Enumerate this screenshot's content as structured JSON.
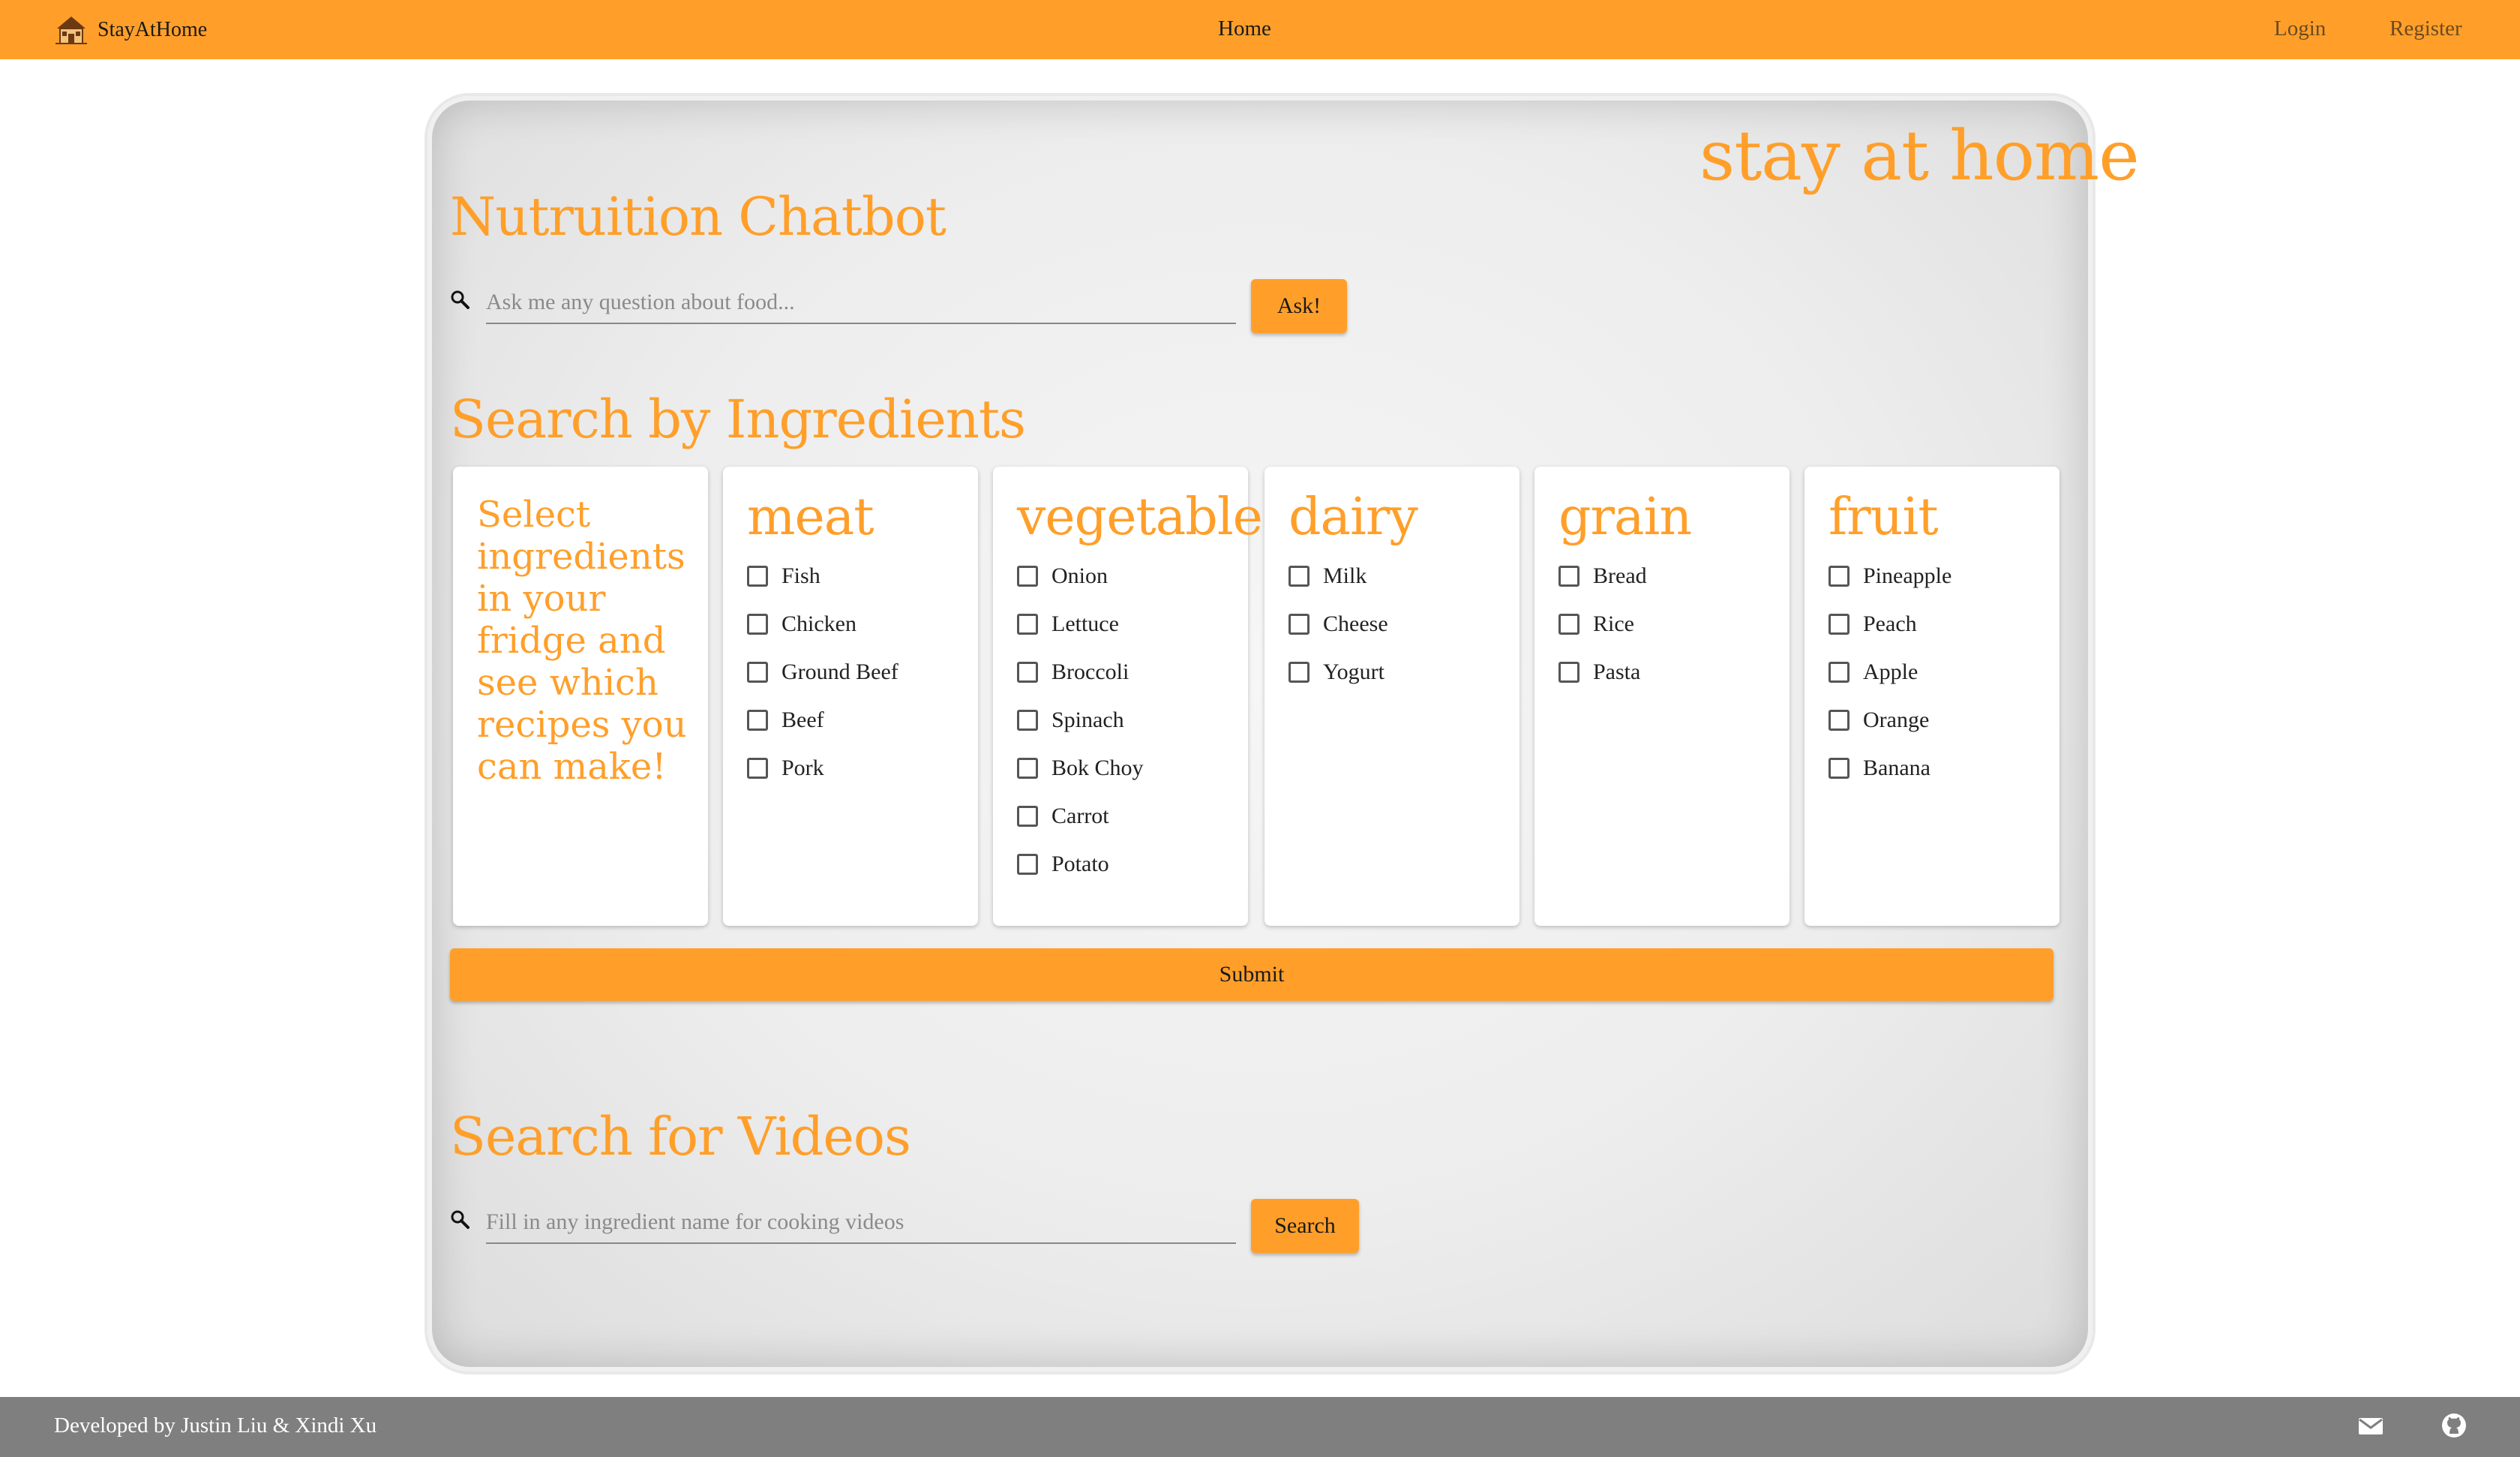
{
  "navbar": {
    "brand": "StayAtHome",
    "brand_icon": "house-icon",
    "center_link": "Home",
    "login": "Login",
    "register": "Register",
    "color": "#ff9f2a"
  },
  "hero": {
    "title": "stay at home"
  },
  "chatbot": {
    "heading": "Nutruition Chatbot",
    "placeholder": "Ask me any question about food...",
    "button": "Ask!"
  },
  "ingredients": {
    "heading": "Search by Ingredients",
    "intro": "Select ingredients in your fridge and see which recipes you can make!",
    "categories": [
      {
        "name": "meat",
        "items": [
          "Fish",
          "Chicken",
          "Ground Beef",
          "Beef",
          "Pork"
        ]
      },
      {
        "name": "vegetable",
        "items": [
          "Onion",
          "Lettuce",
          "Broccoli",
          "Spinach",
          "Bok Choy",
          "Carrot",
          "Potato"
        ]
      },
      {
        "name": "dairy",
        "items": [
          "Milk",
          "Cheese",
          "Yogurt"
        ]
      },
      {
        "name": "grain",
        "items": [
          "Bread",
          "Rice",
          "Pasta"
        ]
      },
      {
        "name": "fruit",
        "items": [
          "Pineapple",
          "Peach",
          "Apple",
          "Orange",
          "Banana"
        ]
      }
    ],
    "submit": "Submit"
  },
  "videos": {
    "heading": "Search for Videos",
    "placeholder": "Fill in any ingredient name for cooking videos",
    "button": "Search"
  },
  "footer": {
    "text": "Developed by Justin Liu & Xindi Xu",
    "icons": [
      "mail-icon",
      "github-icon"
    ],
    "color": "#7f7f7f"
  }
}
